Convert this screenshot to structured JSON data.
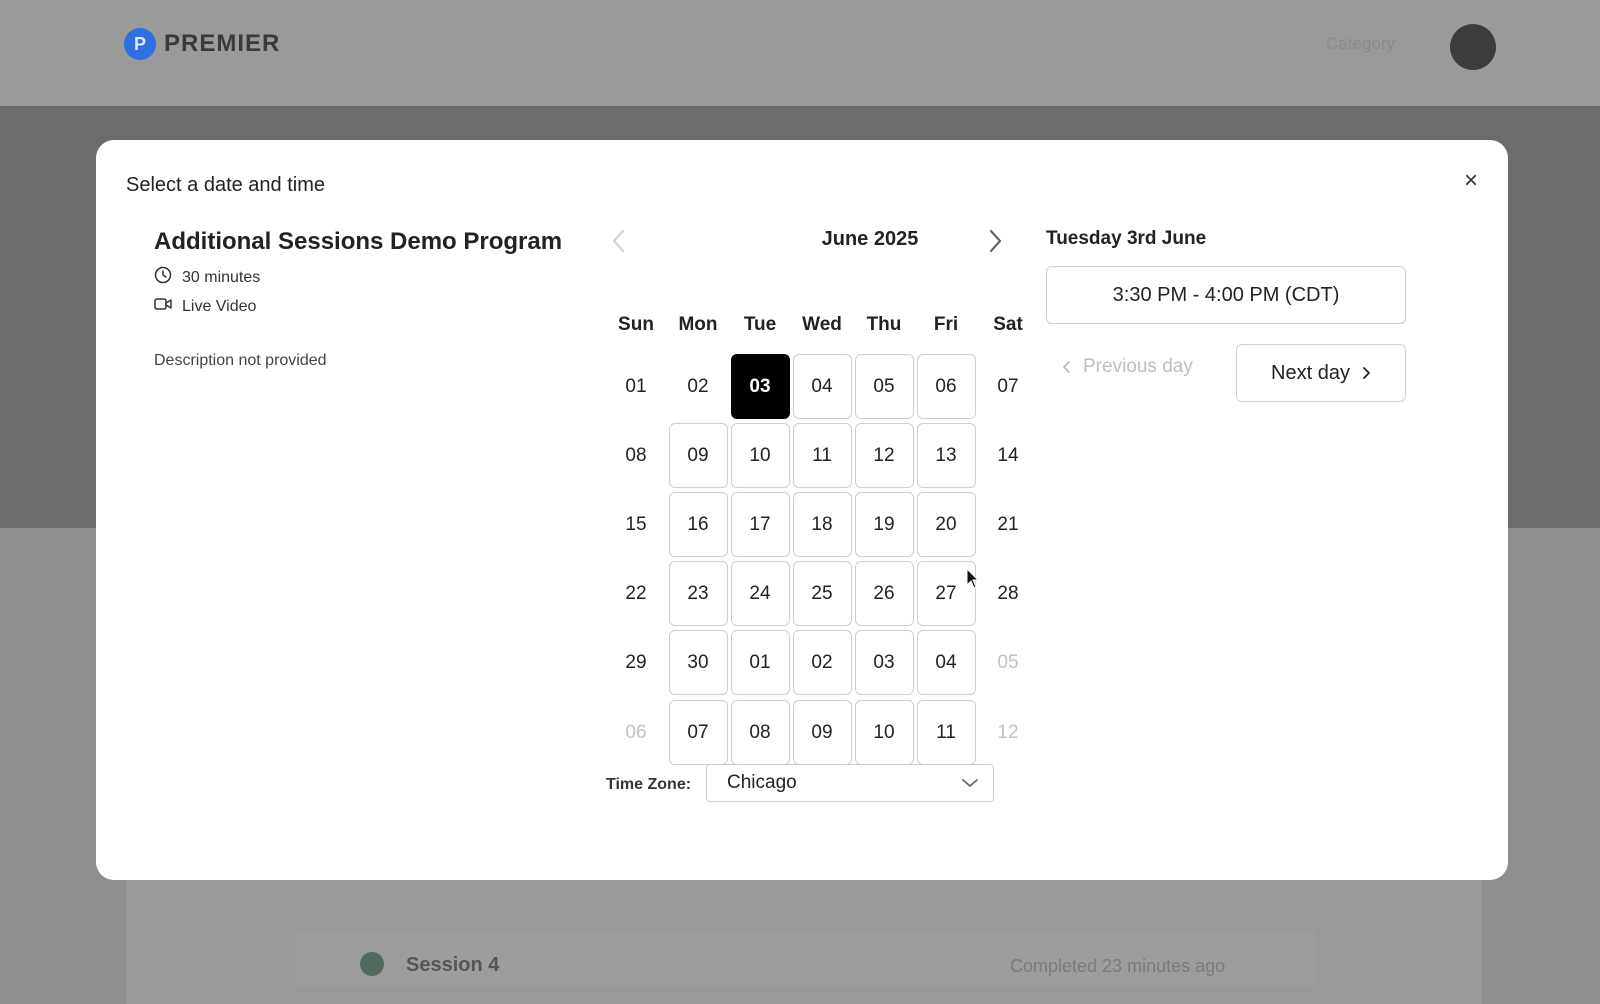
{
  "background": {
    "logo_mark": "P",
    "logo_text": "PREMIER",
    "nav_item": "Category",
    "session_label": "Session 4",
    "session_status": "Completed 23 minutes ago"
  },
  "modal": {
    "title": "Select a date and time",
    "close_label": "×",
    "program": {
      "title": "Additional Sessions Demo Program",
      "duration": "30 minutes",
      "format": "Live Video",
      "description": "Description not provided"
    },
    "calendar": {
      "month_label": "June 2025",
      "weekdays": [
        "Sun",
        "Mon",
        "Tue",
        "Wed",
        "Thu",
        "Fri",
        "Sat"
      ],
      "weeks": [
        [
          {
            "d": "01",
            "s": "plain"
          },
          {
            "d": "02",
            "s": "plain"
          },
          {
            "d": "03",
            "s": "selected"
          },
          {
            "d": "04",
            "s": "boxed"
          },
          {
            "d": "05",
            "s": "boxed"
          },
          {
            "d": "06",
            "s": "boxed"
          },
          {
            "d": "07",
            "s": "plain"
          }
        ],
        [
          {
            "d": "08",
            "s": "plain"
          },
          {
            "d": "09",
            "s": "boxed"
          },
          {
            "d": "10",
            "s": "boxed"
          },
          {
            "d": "11",
            "s": "boxed"
          },
          {
            "d": "12",
            "s": "boxed"
          },
          {
            "d": "13",
            "s": "boxed"
          },
          {
            "d": "14",
            "s": "plain"
          }
        ],
        [
          {
            "d": "15",
            "s": "plain"
          },
          {
            "d": "16",
            "s": "boxed"
          },
          {
            "d": "17",
            "s": "boxed"
          },
          {
            "d": "18",
            "s": "boxed"
          },
          {
            "d": "19",
            "s": "boxed"
          },
          {
            "d": "20",
            "s": "boxed"
          },
          {
            "d": "21",
            "s": "plain"
          }
        ],
        [
          {
            "d": "22",
            "s": "plain"
          },
          {
            "d": "23",
            "s": "boxed"
          },
          {
            "d": "24",
            "s": "boxed"
          },
          {
            "d": "25",
            "s": "boxed"
          },
          {
            "d": "26",
            "s": "boxed"
          },
          {
            "d": "27",
            "s": "boxed"
          },
          {
            "d": "28",
            "s": "plain"
          }
        ],
        [
          {
            "d": "29",
            "s": "plain"
          },
          {
            "d": "30",
            "s": "boxed"
          },
          {
            "d": "01",
            "s": "boxed"
          },
          {
            "d": "02",
            "s": "boxed"
          },
          {
            "d": "03",
            "s": "boxed"
          },
          {
            "d": "04",
            "s": "boxed"
          },
          {
            "d": "05",
            "s": "muted"
          }
        ],
        [
          {
            "d": "06",
            "s": "muted"
          },
          {
            "d": "07",
            "s": "boxed"
          },
          {
            "d": "08",
            "s": "boxed"
          },
          {
            "d": "09",
            "s": "boxed"
          },
          {
            "d": "10",
            "s": "boxed"
          },
          {
            "d": "11",
            "s": "boxed"
          },
          {
            "d": "12",
            "s": "muted"
          }
        ]
      ],
      "timezone_label": "Time Zone:",
      "timezone_value": "Chicago"
    },
    "schedule": {
      "selected_date": "Tuesday 3rd June",
      "slots": [
        "3:30 PM - 4:00 PM (CDT)"
      ],
      "previous_day_label": "Previous day",
      "next_day_label": "Next day"
    }
  },
  "colors": {
    "selected_day_bg": "#000000",
    "logo_blue": "#2f6fe0",
    "border": "#cfcfcf"
  }
}
